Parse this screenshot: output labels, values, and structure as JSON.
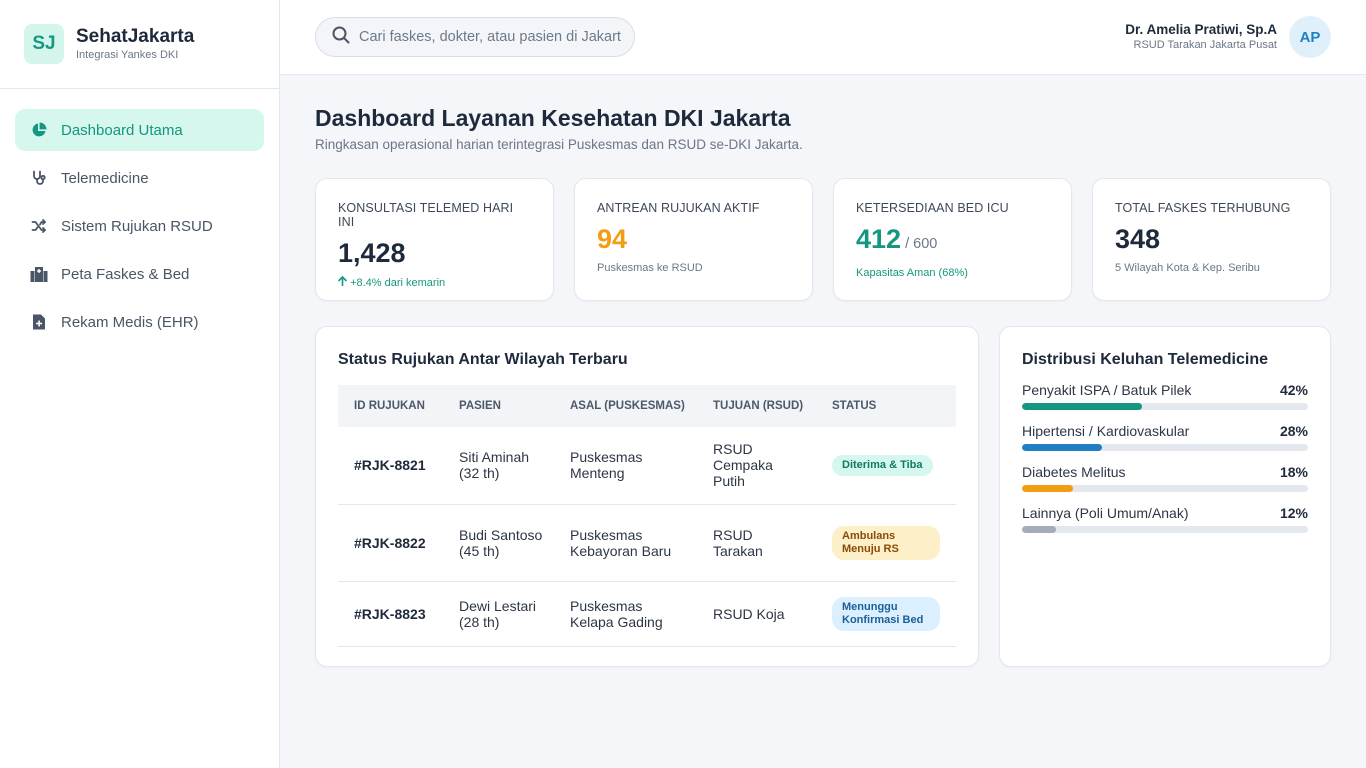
{
  "brand": {
    "initials": "SJ",
    "name": "SehatJakarta",
    "subtitle": "Integrasi Yankes DKI"
  },
  "sidebar": {
    "items": [
      {
        "label": "Dashboard Utama",
        "icon": "pie-chart-icon",
        "active": true
      },
      {
        "label": "Telemedicine",
        "icon": "stethoscope-icon",
        "active": false
      },
      {
        "label": "Sistem Rujukan RSUD",
        "icon": "shuffle-icon",
        "active": false
      },
      {
        "label": "Peta Faskes & Bed",
        "icon": "hospital-icon",
        "active": false
      },
      {
        "label": "Rekam Medis (EHR)",
        "icon": "medical-file-icon",
        "active": false
      }
    ]
  },
  "header": {
    "search_placeholder": "Cari faskes, dokter, atau pasien di Jakarta...",
    "user_name": "Dr. Amelia Pratiwi, Sp.A",
    "user_org": "RSUD Tarakan Jakarta Pusat",
    "user_initials": "AP"
  },
  "page": {
    "title": "Dashboard Layanan Kesehatan DKI Jakarta",
    "subtitle": "Ringkasan operasional harian terintegrasi Puskesmas dan RSUD se-DKI Jakarta."
  },
  "stats": [
    {
      "label": "KONSULTASI TELEMED HARI INI",
      "value": "1,428",
      "unit": "",
      "note": "+8.4% dari kemarin"
    },
    {
      "label": "ANTREAN RUJUKAN AKTIF",
      "value": "94",
      "unit": "",
      "note": "Puskesmas ke RSUD"
    },
    {
      "label": "KETERSEDIAAN BED ICU",
      "value": "412",
      "unit": " / 600",
      "note": "Kapasitas Aman (68%)"
    },
    {
      "label": "TOTAL FASKES TERHUBUNG",
      "value": "348",
      "unit": "",
      "note": "5 Wilayah Kota & Kep. Seribu"
    }
  ],
  "referrals": {
    "title": "Status Rujukan Antar Wilayah Terbaru",
    "columns": [
      "ID RUJUKAN",
      "PASIEN",
      "ASAL (PUSKESMAS)",
      "TUJUAN (RSUD)",
      "STATUS"
    ],
    "rows": [
      {
        "id": "#RJK-8821",
        "patient": "Siti Aminah (32 th)",
        "origin": "Puskesmas Menteng",
        "destination": "RSUD Cempaka Putih",
        "status": "Diterima & Tiba",
        "status_type": "success"
      },
      {
        "id": "#RJK-8822",
        "patient": "Budi Santoso (45 th)",
        "origin": "Puskesmas Kebayoran Baru",
        "destination": "RSUD Tarakan",
        "status": "Ambulans Menuju RS",
        "status_type": "warning"
      },
      {
        "id": "#RJK-8823",
        "patient": "Dewi Lestari (28 th)",
        "origin": "Puskesmas Kelapa Gading",
        "destination": "RSUD Koja",
        "status": "Menunggu Konfirmasi Bed",
        "status_type": "info"
      }
    ]
  },
  "distribution": {
    "title": "Distribusi Keluhan Telemedicine",
    "items": [
      {
        "label": "Penyakit ISPA / Batuk Pilek",
        "pct": "42%",
        "value": 42,
        "color": "#14977e"
      },
      {
        "label": "Hipertensi / Kardiovaskular",
        "pct": "28%",
        "value": 28,
        "color": "#1f7fc4"
      },
      {
        "label": "Diabetes Melitus",
        "pct": "18%",
        "value": 18,
        "color": "#f29d12"
      },
      {
        "label": "Lainnya (Poli Umum/Anak)",
        "pct": "12%",
        "value": 12,
        "color": "#a3acb9"
      }
    ]
  },
  "colors": {
    "accent": "#14977e",
    "success_bg": "#d6f7ee",
    "success_fg": "#0f7a63",
    "warning_bg": "#fdefc7",
    "warning_fg": "#8a4b07",
    "info_bg": "#dcefff",
    "info_fg": "#1a5f96"
  }
}
